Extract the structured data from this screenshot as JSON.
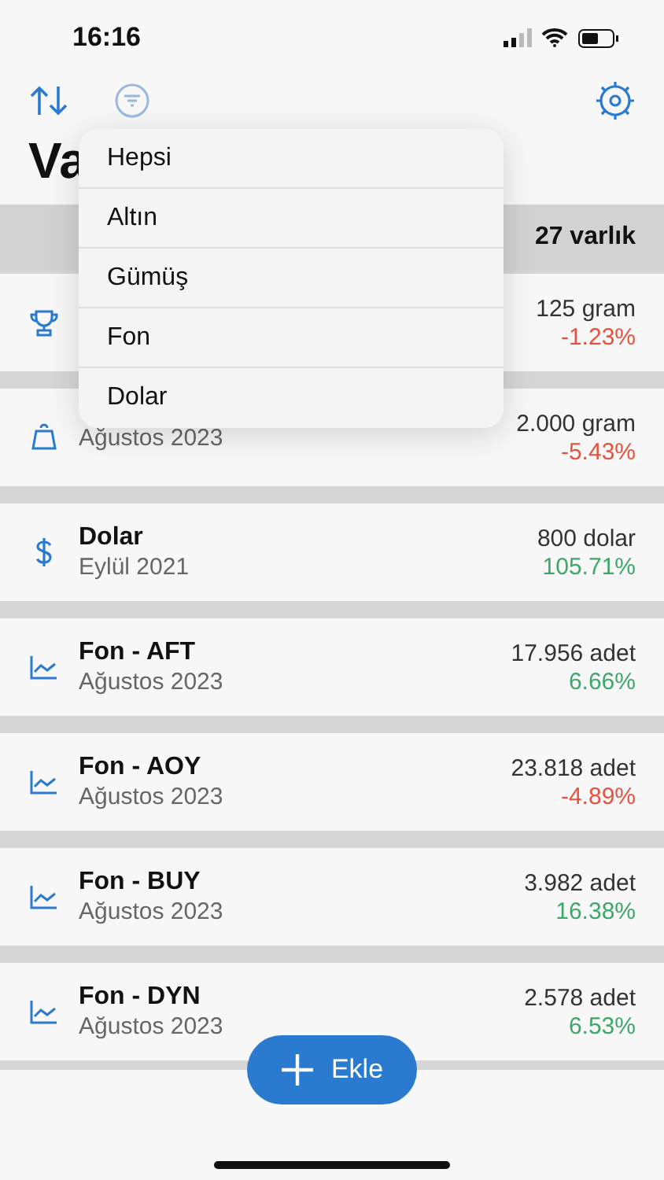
{
  "status_bar": {
    "time": "16:16"
  },
  "title": "Va",
  "header": {
    "count": "27 varlık"
  },
  "filter_menu": [
    {
      "label": "Hepsi"
    },
    {
      "label": "Altın"
    },
    {
      "label": "Gümüş"
    },
    {
      "label": "Fon"
    },
    {
      "label": "Dolar"
    }
  ],
  "assets": [
    {
      "kind": "trophy",
      "amount": "125 gram",
      "change": "-1.23%",
      "color": "#e5533f"
    },
    {
      "kind": "scale",
      "date": "Ağustos 2023",
      "amount": "2.000 gram",
      "change": "-5.43%",
      "color": "#e5533f"
    },
    {
      "kind": "dollar",
      "name": "Dolar",
      "date": "Eylül 2021",
      "amount": "800 dolar",
      "change": "105.71%",
      "color": "#3fa66a"
    },
    {
      "kind": "chart",
      "name": "Fon - AFT",
      "date": "Ağustos 2023",
      "amount": "17.956 adet",
      "change": "6.66%",
      "color": "#3fa66a"
    },
    {
      "kind": "chart",
      "name": "Fon - AOY",
      "date": "Ağustos 2023",
      "amount": "23.818 adet",
      "change": "-4.89%",
      "color": "#e5533f"
    },
    {
      "kind": "chart",
      "name": "Fon - BUY",
      "date": "Ağustos 2023",
      "amount": "3.982 adet",
      "change": "16.38%",
      "color": "#3fa66a"
    },
    {
      "kind": "chart",
      "name": "Fon - DYN",
      "date": "Ağustos 2023",
      "amount": "2.578 adet",
      "change": "6.53%",
      "color": "#3fa66a"
    }
  ],
  "add_button": {
    "label": "Ekle"
  }
}
